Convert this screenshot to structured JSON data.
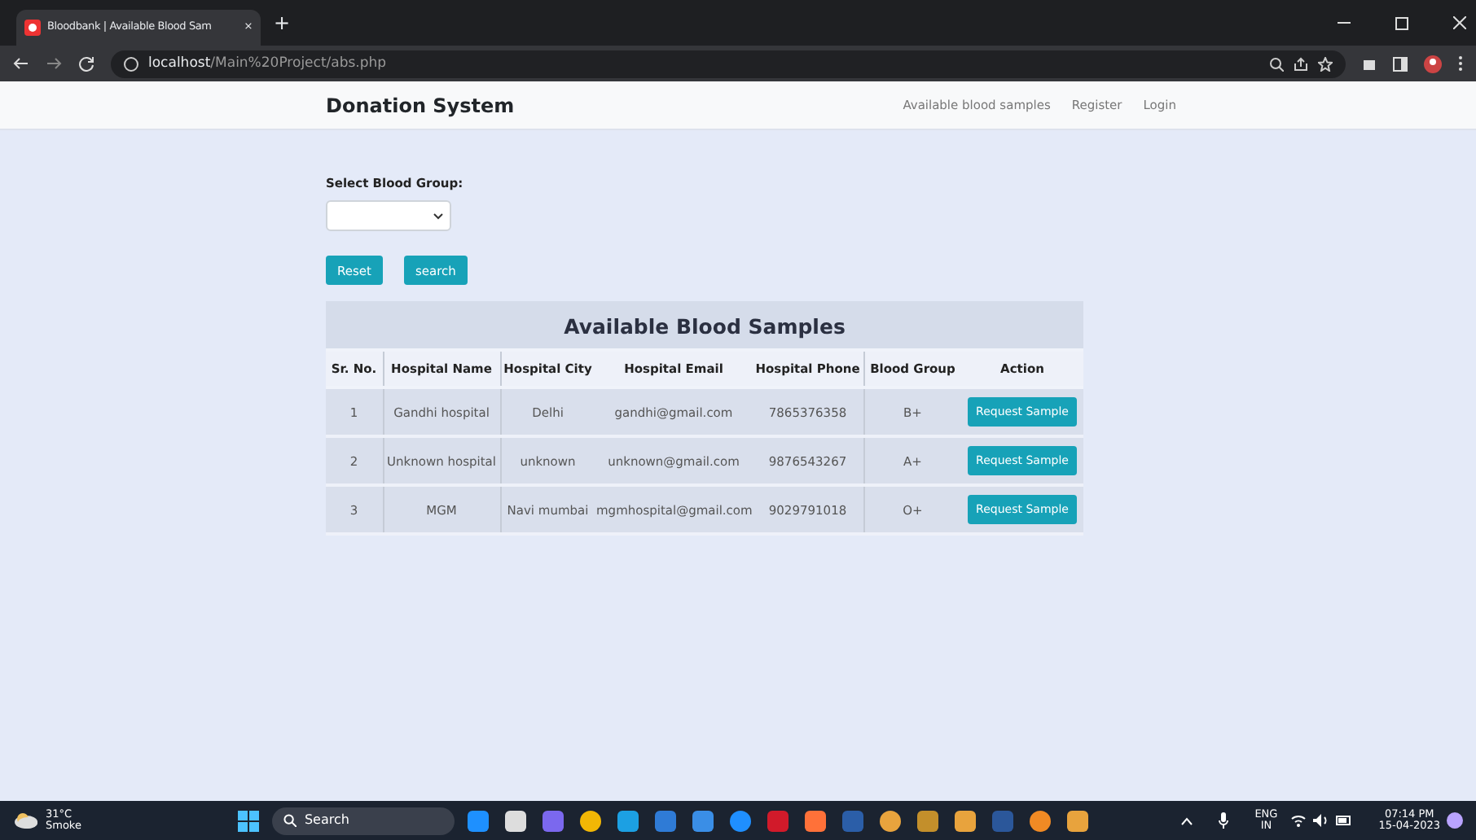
{
  "browser": {
    "tab_title": "Bloodbank | Available Blood Sam",
    "tab_close": "×",
    "new_tab": "+",
    "url_host": "localhost",
    "url_path": "/Main%20Project/abs.php"
  },
  "navbar": {
    "brand": "Donation System",
    "links": [
      {
        "label": "Available blood samples"
      },
      {
        "label": "Register"
      },
      {
        "label": "Login"
      }
    ]
  },
  "filter": {
    "label": "Select Blood Group:",
    "buttons": [
      {
        "label": "Reset"
      },
      {
        "label": "search"
      }
    ]
  },
  "table": {
    "title": "Available Blood Samples",
    "columns": [
      "Sr. No.",
      "Hospital Name",
      "Hospital City",
      "Hospital Email",
      "Hospital Phone",
      "Blood Group",
      "Action"
    ],
    "rows": [
      {
        "cells": [
          "1",
          "Gandhi hospital",
          "Delhi",
          "gandhi@gmail.com",
          "7865376358",
          "B+"
        ],
        "action": "Request Sample"
      },
      {
        "cells": [
          "2",
          "Unknown hospital",
          "unknown",
          "unknown@gmail.com",
          "9876543267",
          "A+"
        ],
        "action": "Request Sample"
      },
      {
        "cells": [
          "3",
          "MGM",
          "Navi mumbai",
          "mgmhospital@gmail.com",
          "9029791018",
          "O+"
        ],
        "action": "Request Sample"
      }
    ]
  },
  "taskbar": {
    "temperature": "31°C",
    "weather": "Smoke",
    "search": "Search",
    "language": "ENG",
    "region": "IN",
    "time": "07:14 PM",
    "date": "15-04-2023"
  }
}
